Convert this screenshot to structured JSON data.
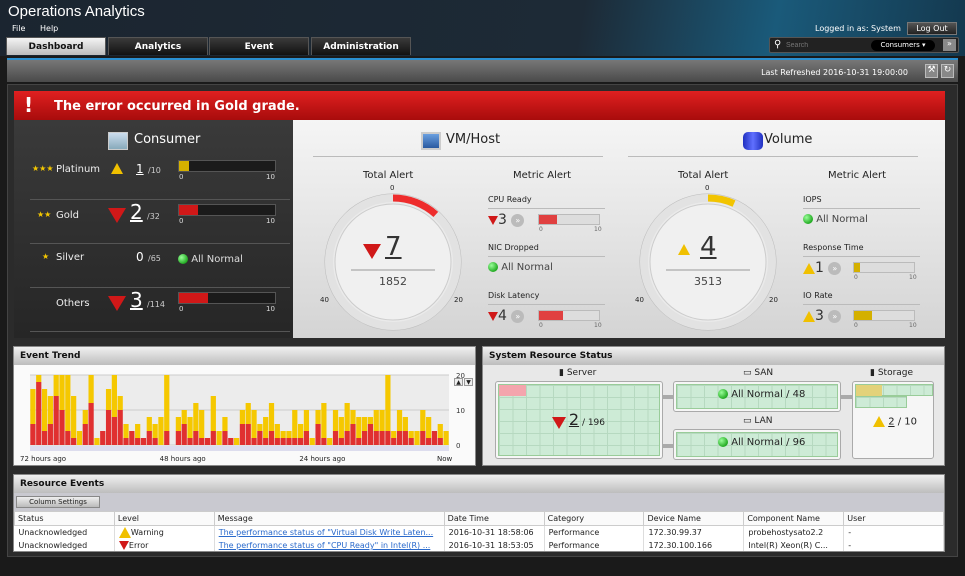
{
  "app": {
    "title": "Operations Analytics",
    "menu": [
      "File",
      "Help"
    ],
    "logged_in": "Logged in as: System",
    "logout": "Log Out",
    "search_placeholder": "Search",
    "search_scope": "Consumers ▾",
    "tabs": [
      "Dashboard",
      "Analytics",
      "Event",
      "Administration"
    ],
    "active_tab": "Dashboard"
  },
  "toolbar": {
    "last_refreshed": "Last Refreshed 2016-10-31 19:00:00"
  },
  "banner": {
    "message": "The error occurred in Gold grade."
  },
  "consumer": {
    "title": "Consumer",
    "rows": [
      {
        "stars": "★★★",
        "name": "Platinum",
        "status": "warning",
        "count": "1",
        "total": "/10",
        "fill": 0.1,
        "min": "0",
        "max": "10"
      },
      {
        "stars": "★★",
        "name": "Gold",
        "status": "error",
        "count": "2",
        "total": "/32",
        "fill": 0.2,
        "min": "0",
        "max": "10"
      },
      {
        "stars": "★",
        "name": "Silver",
        "status": "normal",
        "count": "0",
        "total": "/65",
        "normal_text": "All Normal"
      },
      {
        "stars": "",
        "name": "Others",
        "status": "error",
        "count": "3",
        "total": "/114",
        "fill": 0.3,
        "min": "0",
        "max": "10"
      }
    ]
  },
  "vmhost": {
    "title": "VM/Host",
    "total_label": "Total Alert",
    "metric_label": "Metric Alert",
    "alert": "7",
    "total": "1852",
    "gauge_max": 60,
    "ticks": [
      "0",
      "20",
      "40"
    ],
    "metrics": [
      {
        "name": "CPU Ready",
        "status": "error",
        "count": "3",
        "fill": 0.3,
        "min": "0",
        "max": "10"
      },
      {
        "name": "NIC Dropped",
        "status": "normal",
        "text": "All Normal"
      },
      {
        "name": "Disk Latency",
        "status": "error",
        "count": "4",
        "fill": 0.4,
        "min": "0",
        "max": "10"
      }
    ]
  },
  "volume": {
    "title": "Volume",
    "total_label": "Total Alert",
    "metric_label": "Metric Alert",
    "alert": "4",
    "total": "3513",
    "gauge_max": 60,
    "ticks": [
      "0",
      "20",
      "40"
    ],
    "metrics": [
      {
        "name": "IOPS",
        "status": "normal",
        "text": "All Normal"
      },
      {
        "name": "Response Time",
        "status": "warning",
        "count": "1",
        "fill": 0.1,
        "min": "0",
        "max": "10"
      },
      {
        "name": "IO Rate",
        "status": "warning",
        "count": "3",
        "fill": 0.3,
        "min": "0",
        "max": "10"
      }
    ]
  },
  "event_trend": {
    "title": "Event Trend"
  },
  "chart_data": {
    "type": "bar",
    "stacked": true,
    "ylim": [
      0,
      20
    ],
    "yticks": [
      "0",
      "10",
      "20"
    ],
    "xticks": [
      "72 hours ago",
      "48 hours ago",
      "24 hours ago",
      "Now"
    ],
    "series": [
      {
        "name": "Error",
        "color": "#e03030",
        "values": [
          6,
          18,
          4,
          6,
          14,
          10,
          4,
          2,
          0,
          6,
          12,
          0,
          4,
          10,
          8,
          10,
          2,
          4,
          2,
          2,
          4,
          2,
          0,
          4,
          0,
          4,
          6,
          2,
          4,
          2,
          2,
          4,
          0,
          4,
          2,
          0,
          6,
          6,
          2,
          4,
          2,
          4,
          2,
          2,
          2,
          2,
          2,
          4,
          0,
          6,
          2,
          0,
          4,
          2,
          4,
          6,
          2,
          4,
          6,
          4,
          4,
          4,
          2,
          4,
          4,
          2,
          0,
          4,
          2,
          4,
          2,
          0
        ]
      },
      {
        "name": "Warning",
        "color": "#f5c800",
        "values": [
          10,
          2,
          12,
          8,
          6,
          10,
          16,
          12,
          4,
          4,
          8,
          2,
          0,
          6,
          12,
          4,
          4,
          0,
          4,
          0,
          4,
          4,
          8,
          16,
          0,
          4,
          4,
          6,
          8,
          8,
          0,
          10,
          4,
          4,
          0,
          2,
          4,
          6,
          8,
          2,
          6,
          8,
          4,
          2,
          2,
          8,
          4,
          6,
          2,
          4,
          10,
          2,
          6,
          6,
          8,
          4,
          6,
          4,
          2,
          6,
          6,
          16,
          2,
          6,
          4,
          2,
          4,
          6,
          6,
          0,
          4,
          4
        ]
      }
    ]
  },
  "system": {
    "title": "System Resource Status",
    "server": {
      "label": "Server",
      "count": "2",
      "total": "/ 196"
    },
    "san": {
      "label": "SAN",
      "text": "All Normal / 48"
    },
    "lan": {
      "label": "LAN",
      "text": "All Normal / 96"
    },
    "storage": {
      "label": "Storage",
      "count": "2",
      "total": "/ 10"
    }
  },
  "events": {
    "title": "Resource Events",
    "column_settings": "Column Settings",
    "columns": [
      "Status",
      "Level",
      "Message",
      "Date Time",
      "Category",
      "Device Name",
      "Component Name",
      "User"
    ],
    "rows": [
      [
        "Unacknowledged",
        "Warning",
        "The performance status of \"Virtual Disk Write Laten...",
        "2016-10-31 18:58:06",
        "Performance",
        "172.30.99.37",
        "probehostysato2.2",
        "-"
      ],
      [
        "Unacknowledged",
        "Error",
        "The performance status of \"CPU Ready\" in Intel(R) ...",
        "2016-10-31 18:53:05",
        "Performance",
        "172.30.100.166",
        "Intel(R) Xeon(R) C...",
        "-"
      ]
    ]
  }
}
